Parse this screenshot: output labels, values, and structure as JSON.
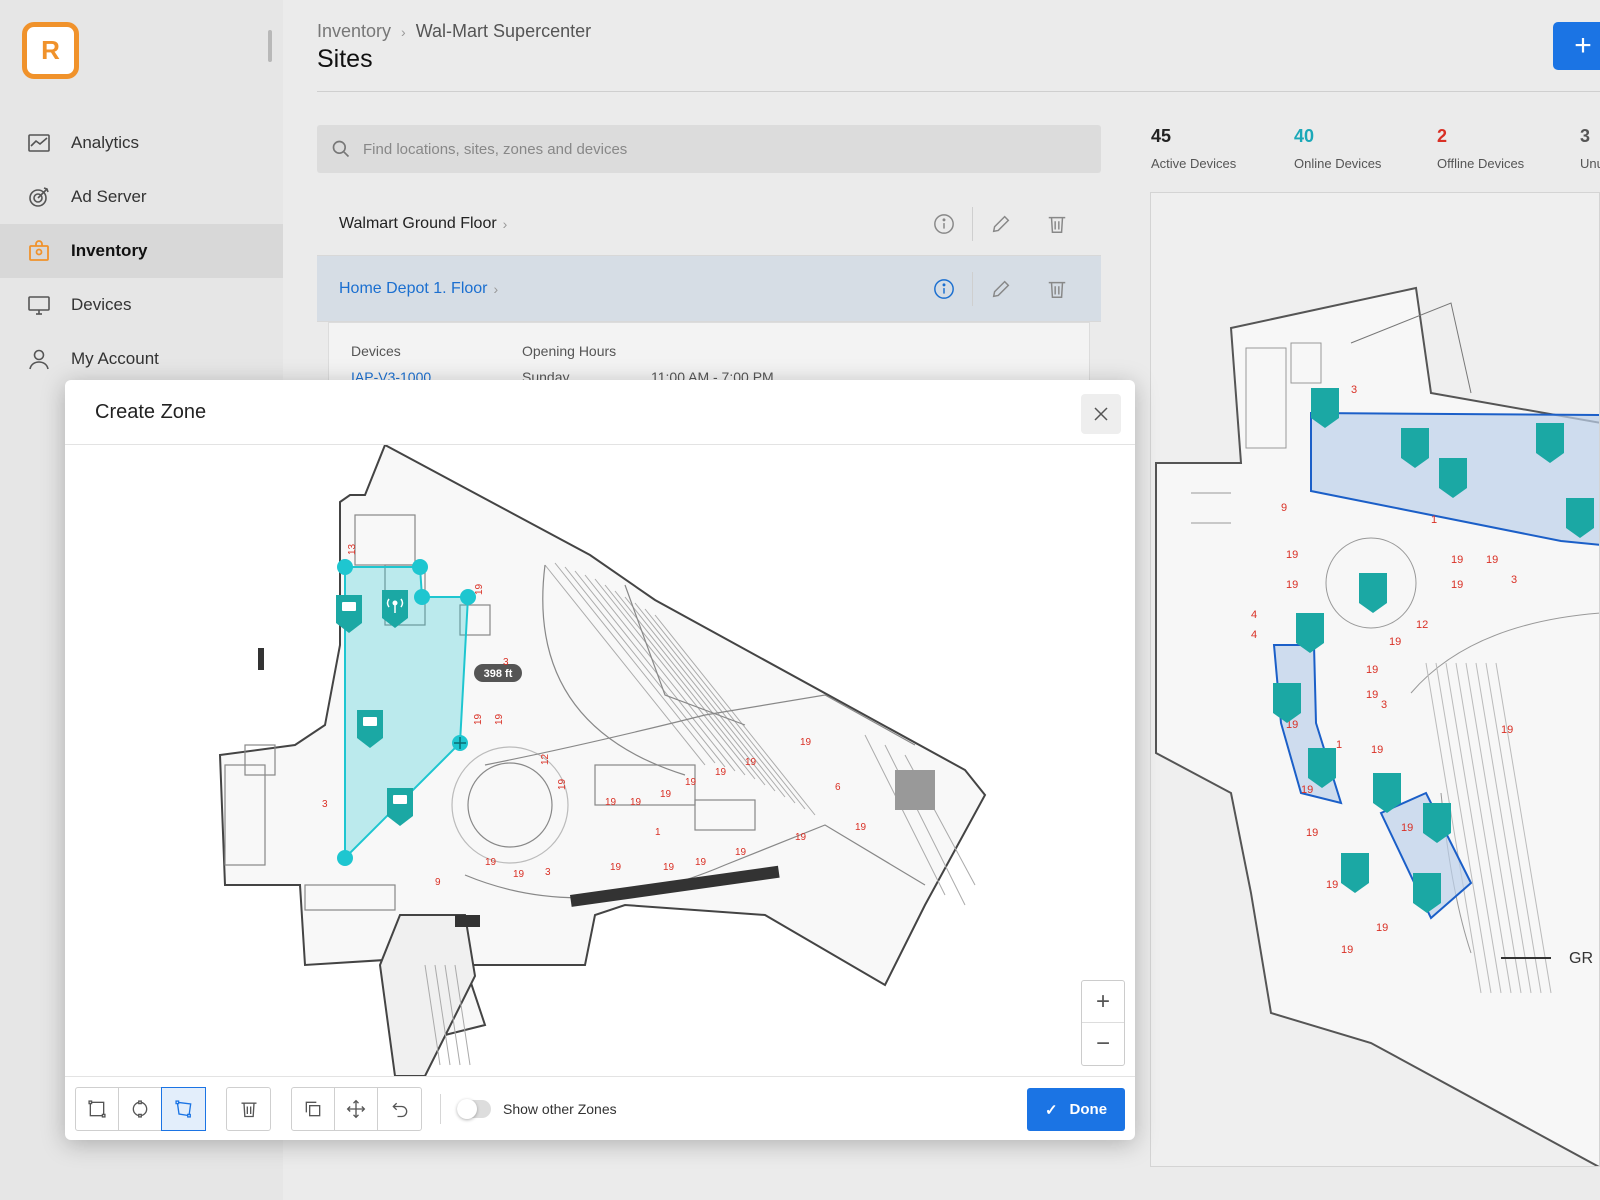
{
  "app": {
    "logo_letter": "R"
  },
  "sidebar": {
    "items": [
      {
        "label": "Analytics",
        "icon": "chart-icon"
      },
      {
        "label": "Ad Server",
        "icon": "target-icon"
      },
      {
        "label": "Inventory",
        "icon": "inventory-icon",
        "active": true
      },
      {
        "label": "Devices",
        "icon": "monitor-icon"
      },
      {
        "label": "My Account",
        "icon": "user-icon"
      }
    ]
  },
  "header": {
    "breadcrumb": [
      "Inventory",
      "Wal-Mart Supercenter"
    ],
    "title": "Sites",
    "add_label": "+"
  },
  "search": {
    "placeholder": "Find locations, sites, zones and devices",
    "value": ""
  },
  "sites": [
    {
      "name": "Walmart Ground Floor"
    },
    {
      "name": "Home Depot 1. Floor",
      "selected": true
    }
  ],
  "site_detail": {
    "devices_label": "Devices",
    "hours_label": "Opening Hours",
    "device_value": "IAP-V3-1000",
    "day": "Sunday",
    "hours": "11:00 AM - 7:00 PM"
  },
  "stats": [
    {
      "value": "45",
      "label": "Active Devices",
      "color": "#222222"
    },
    {
      "value": "40",
      "label": "Online Devices",
      "color": "#1ba8b8"
    },
    {
      "value": "2",
      "label": "Offline Devices",
      "color": "#d93025"
    },
    {
      "value": "3",
      "label": "Unu",
      "color": "#555555"
    }
  ],
  "modal": {
    "title": "Create Zone",
    "distance_label": "398 ft",
    "zoom_in": "+",
    "zoom_out": "−",
    "show_other_zones_label": "Show other Zones",
    "show_other_zones": false,
    "done_label": "Done"
  },
  "right_map": {
    "label": "GR"
  },
  "colors": {
    "accent": "#1b74e4",
    "brand": "#f0922b",
    "zone": "#1ec6d0",
    "marker": "#1ba8a4"
  }
}
